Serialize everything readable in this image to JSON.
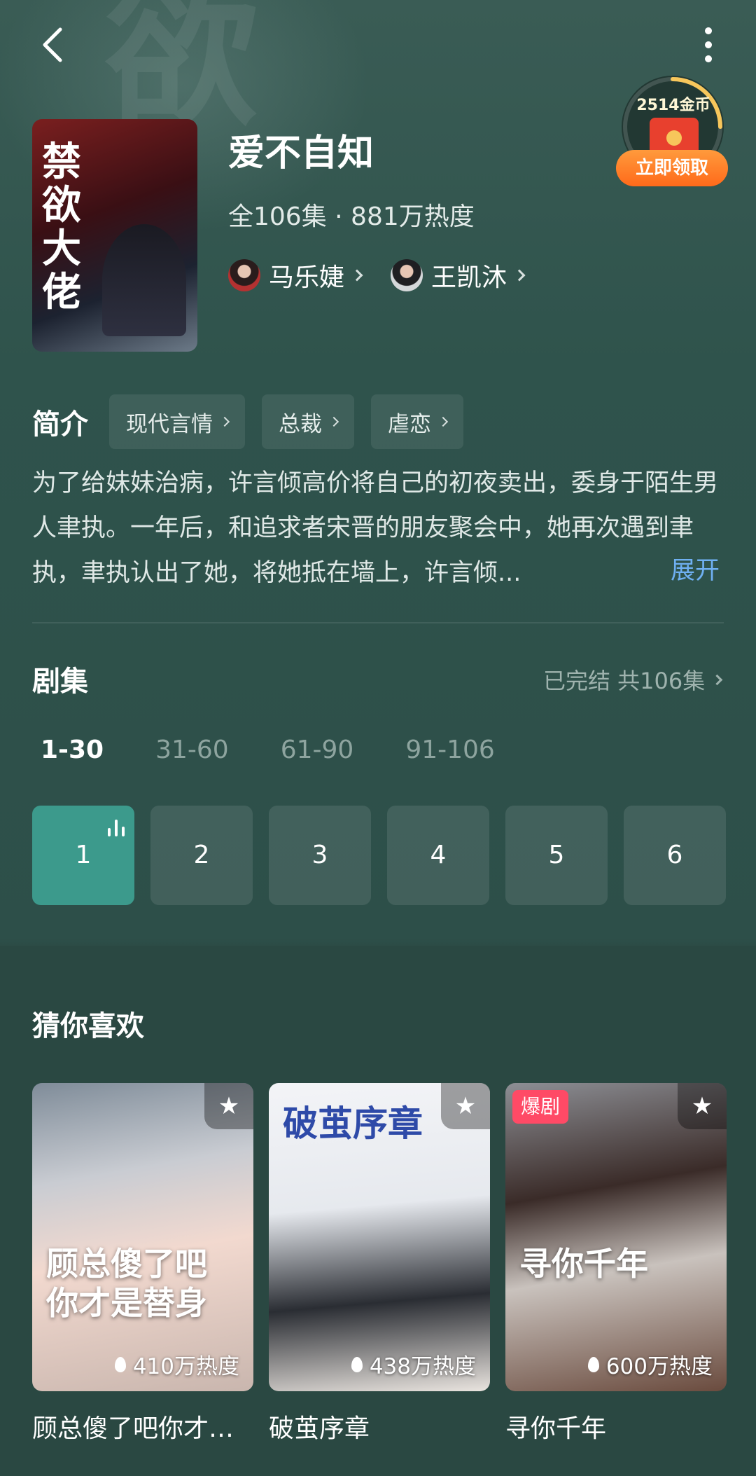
{
  "header": {
    "back_icon": "chevron-left-icon",
    "more_icon": "vertical-dots-icon"
  },
  "coin_widget": {
    "amount": "2514金币",
    "claim_label": "立即领取",
    "icon": "red-envelope-icon"
  },
  "poster": {
    "title_art": "禁欲大佬"
  },
  "drama": {
    "title": "爱不自知",
    "meta": "全106集 · 881万热度",
    "actors": [
      {
        "name": "马乐婕"
      },
      {
        "name": "王凯沐"
      }
    ]
  },
  "intro": {
    "label": "简介",
    "tags": [
      {
        "label": "现代言情"
      },
      {
        "label": "总裁"
      },
      {
        "label": "虐恋"
      }
    ],
    "synopsis": "为了给妹妹治病，许言倾高价将自己的初夜卖出，委身于陌生男人聿执。一年后，和追求者宋晋的朋友聚会中，她再次遇到聿执，聿执认出了她，将她抵在墙上，许言倾...",
    "expand_label": "展开"
  },
  "episodes": {
    "label": "剧集",
    "status": "已完结 共106集",
    "ranges": [
      {
        "label": "1-30",
        "active": true
      },
      {
        "label": "31-60"
      },
      {
        "label": "61-90"
      },
      {
        "label": "91-106"
      }
    ],
    "items": [
      {
        "num": "1",
        "active": true
      },
      {
        "num": "2"
      },
      {
        "num": "3"
      },
      {
        "num": "4"
      },
      {
        "num": "5"
      },
      {
        "num": "6"
      }
    ]
  },
  "recommend": {
    "label": "猜你喜欢",
    "cards": [
      {
        "title": "顾总傻了吧你才是替身",
        "heat": "410万热度",
        "art": "顾总傻了吧你才是替身"
      },
      {
        "title": "破茧序章",
        "heat": "438万热度",
        "art": "破茧序章"
      },
      {
        "title": "寻你千年",
        "heat": "600万热度",
        "art": "寻你千年",
        "badge": "爆剧"
      }
    ]
  },
  "colors": {
    "accent": "#3c9a8c",
    "link": "#6fb0f2",
    "claim": "#ff7a25",
    "badge": "#ff4a66"
  }
}
